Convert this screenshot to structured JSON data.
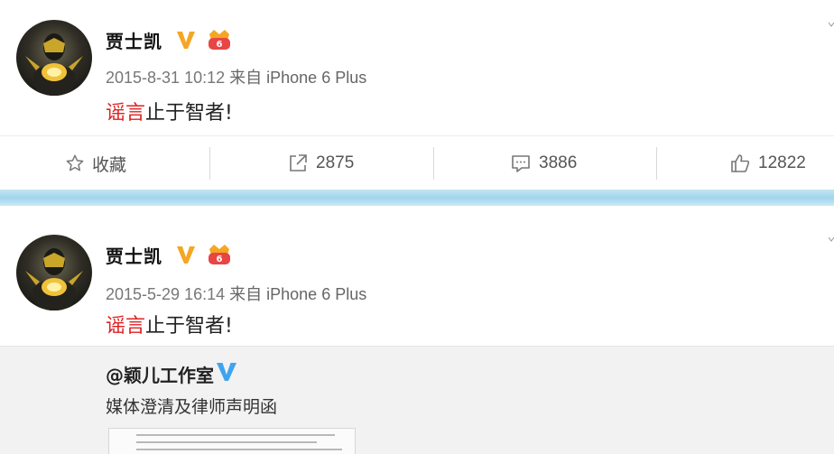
{
  "post1": {
    "username": "贾士凯",
    "timestamp": "2015-8-31 10:12",
    "source_prefix": "来自",
    "source": "iPhone 6 Plus",
    "text_highlight": "谣言",
    "text_rest": "止于智者!",
    "toolbar": {
      "favorite_label": "收藏",
      "repost_count": "2875",
      "comment_count": "3886",
      "like_count": "12822"
    }
  },
  "post2": {
    "username": "贾士凯",
    "timestamp": "2015-5-29 16:14",
    "source_prefix": "来自",
    "source": "iPhone 6 Plus",
    "text_highlight": "谣言",
    "text_rest": "止于智者!",
    "repost": {
      "author": "@颖儿工作室",
      "text": "媒体澄清及律师声明函"
    }
  },
  "colors": {
    "highlight_red": "#e02020",
    "verified_gold": "#f5a623",
    "verified_blue": "#3fa4f0",
    "divider_blue": "#9fd5ec"
  },
  "icons": [
    "star-icon",
    "repost-icon",
    "comment-icon",
    "like-icon",
    "verified-v-icon",
    "vip-badge-icon"
  ]
}
